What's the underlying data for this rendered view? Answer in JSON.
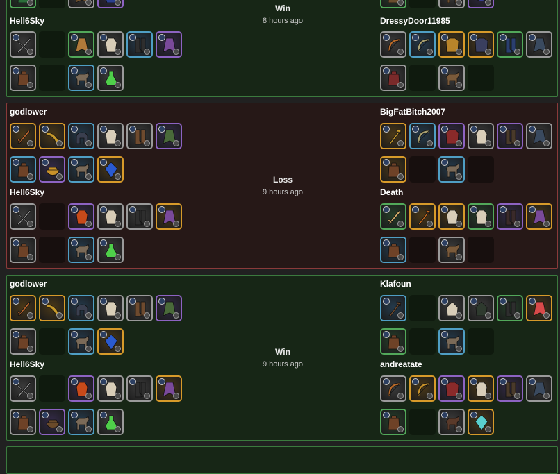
{
  "matches": [
    {
      "kind": "win",
      "result": "Win",
      "time": "8 hours ago",
      "left": [
        {
          "rows": [
            [
              {
                "q": "green",
                "c": "#2b6f3a",
                "icon": "bag-icon"
              },
              {
                "q": "empty"
              },
              {
                "q": "gray",
                "c": "#6b4e2e",
                "icon": "cape-icon"
              },
              {
                "q": "purple",
                "c": "#2a3f8f",
                "icon": "potion-icon"
              }
            ]
          ]
        },
        {
          "name": "Hell6Sky",
          "rows": [
            [
              {
                "q": "gray",
                "c": "#9a9a9a",
                "icon": "crossbow-icon"
              },
              {
                "q": "empty"
              },
              {
                "q": "green",
                "c": "#b07a3a",
                "icon": "cape-icon"
              },
              {
                "q": "gray",
                "c": "#d8cdb8",
                "icon": "robe-icon"
              },
              {
                "q": "blue",
                "c": "#2e2e2e",
                "icon": "boots-icon"
              },
              {
                "q": "purple",
                "c": "#7a4a9a",
                "icon": "cape-icon"
              }
            ],
            [
              {
                "q": "gray",
                "c": "#6e4227",
                "icon": "bag-icon"
              },
              {
                "q": "empty"
              },
              {
                "q": "blue",
                "c": "#7a6a58",
                "icon": "mount-icon"
              },
              {
                "q": "gray",
                "c": "#4fcf4a",
                "icon": "potion-icon"
              }
            ]
          ]
        }
      ],
      "right": [
        {
          "rows": [
            [
              {
                "q": "green",
                "c": "#6b4e2e",
                "icon": "bag-icon"
              },
              {
                "q": "empty"
              },
              {
                "q": "gray",
                "c": "#6b4e2e",
                "icon": "mount-icon"
              },
              {
                "q": "purple",
                "c": "#3a3f8f",
                "icon": "food-icon"
              }
            ]
          ]
        },
        {
          "name": "DressyDoor11985",
          "rows": [
            [
              {
                "q": "gray",
                "c": "#b86a2a",
                "icon": "bow-icon"
              },
              {
                "q": "blue",
                "c": "#a8a070",
                "icon": "bow-icon"
              },
              {
                "q": "gold",
                "c": "#b8842a",
                "icon": "jacket-icon"
              },
              {
                "q": "gold",
                "c": "#3a3f5f",
                "icon": "jacket-icon"
              },
              {
                "q": "green",
                "c": "#2a3f6f",
                "icon": "boots-icon"
              },
              {
                "q": "gray",
                "c": "#3a4a5f",
                "icon": "cape-icon"
              }
            ],
            [
              {
                "q": "gray",
                "c": "#7a2a2a",
                "icon": "bag-icon"
              },
              {
                "q": "empty"
              },
              {
                "q": "gray",
                "c": "#7a5a3a",
                "icon": "mount-icon"
              },
              {
                "q": "empty"
              }
            ]
          ]
        }
      ]
    },
    {
      "kind": "loss",
      "result": "Loss",
      "time": "9 hours ago",
      "left": [
        {
          "name": "godlower",
          "rows": [
            [
              {
                "q": "gold",
                "c": "#b8642a",
                "icon": "sword-icon"
              },
              {
                "q": "gold",
                "c": "#c89a2a",
                "icon": "horn-icon"
              },
              {
                "q": "blue",
                "c": "#3a3f4f",
                "icon": "helmet-icon"
              },
              {
                "q": "gray",
                "c": "#d8cdb8",
                "icon": "robe-icon"
              },
              {
                "q": "gray",
                "c": "#6e4a2e",
                "icon": "boots-icon"
              },
              {
                "q": "purple",
                "c": "#4a6a3a",
                "icon": "cape-icon"
              }
            ],
            [
              {
                "q": "blue",
                "c": "#6e4227",
                "icon": "bag-icon"
              },
              {
                "q": "purple",
                "c": "#c8922a",
                "icon": "food-icon"
              },
              {
                "q": "blue",
                "c": "#7a6a58",
                "icon": "mount-icon"
              },
              {
                "q": "gold",
                "c": "#2a5acf",
                "icon": "gem-icon"
              }
            ]
          ]
        },
        {
          "name": "Hell6Sky",
          "rows": [
            [
              {
                "q": "gray",
                "c": "#9a9a9a",
                "icon": "crossbow-icon"
              },
              {
                "q": "empty"
              },
              {
                "q": "purple",
                "c": "#c84a1a",
                "icon": "robe-icon"
              },
              {
                "q": "gray",
                "c": "#d8cdb8",
                "icon": "robe-icon"
              },
              {
                "q": "gray",
                "c": "#2e2e2e",
                "icon": "boots-icon"
              },
              {
                "q": "gold",
                "c": "#7a4a9a",
                "icon": "cape-icon"
              }
            ],
            [
              {
                "q": "gray",
                "c": "#6e4227",
                "icon": "bag-icon"
              },
              {
                "q": "empty"
              },
              {
                "q": "blue",
                "c": "#7a6a58",
                "icon": "mount-icon"
              },
              {
                "q": "gray",
                "c": "#4fcf4a",
                "icon": "potion-icon"
              }
            ]
          ]
        }
      ],
      "right": [
        {
          "name": "BigFatBitch2007",
          "rows": [
            [
              {
                "q": "gold",
                "c": "#c89a2a",
                "icon": "staff-icon"
              },
              {
                "q": "blue",
                "c": "#a8a070",
                "icon": "bow-icon"
              },
              {
                "q": "purple",
                "c": "#8a2a2a",
                "icon": "jacket-icon"
              },
              {
                "q": "gray",
                "c": "#d8cdb8",
                "icon": "robe-icon"
              },
              {
                "q": "purple",
                "c": "#4a3a2a",
                "icon": "boots-icon"
              },
              {
                "q": "gray",
                "c": "#3a4a5f",
                "icon": "cape-icon"
              }
            ],
            [
              {
                "q": "gold",
                "c": "#6e4227",
                "icon": "bag-icon"
              },
              {
                "q": "empty"
              },
              {
                "q": "blue",
                "c": "#7a6a58",
                "icon": "mount-icon"
              },
              {
                "q": "empty"
              }
            ]
          ]
        },
        {
          "name": "Death",
          "rows": [
            [
              {
                "q": "green",
                "c": "#d8b06a",
                "icon": "sword-icon"
              },
              {
                "q": "gold",
                "c": "#c86a1a",
                "icon": "staff-icon"
              },
              {
                "q": "gold",
                "c": "#d8cdb8",
                "icon": "robe-icon"
              },
              {
                "q": "green",
                "c": "#d8cdb8",
                "icon": "robe-icon"
              },
              {
                "q": "purple",
                "c": "#3a2a2a",
                "icon": "boots-icon"
              },
              {
                "q": "gold",
                "c": "#7a4a9a",
                "icon": "cape-icon"
              }
            ],
            [
              {
                "q": "blue",
                "c": "#6e4227",
                "icon": "bag-icon"
              },
              {
                "q": "empty"
              },
              {
                "q": "gray",
                "c": "#7a5a3a",
                "icon": "mount-icon"
              },
              {
                "q": "empty"
              }
            ]
          ]
        }
      ]
    },
    {
      "kind": "win",
      "result": "Win",
      "time": "9 hours ago",
      "left": [
        {
          "name": "godlower",
          "rows": [
            [
              {
                "q": "gold",
                "c": "#b8642a",
                "icon": "sword-icon"
              },
              {
                "q": "gold",
                "c": "#c89a2a",
                "icon": "horn-icon"
              },
              {
                "q": "blue",
                "c": "#3a3f4f",
                "icon": "helmet-icon"
              },
              {
                "q": "gray",
                "c": "#d8cdb8",
                "icon": "robe-icon"
              },
              {
                "q": "gray",
                "c": "#6e4a2e",
                "icon": "boots-icon"
              },
              {
                "q": "purple",
                "c": "#4a6a3a",
                "icon": "cape-icon"
              }
            ],
            [
              {
                "q": "gray",
                "c": "#6e4227",
                "icon": "bag-icon"
              },
              {
                "q": "empty"
              },
              {
                "q": "blue",
                "c": "#7a6a58",
                "icon": "mount-icon"
              },
              {
                "q": "gold",
                "c": "#2a5acf",
                "icon": "gem-icon"
              }
            ]
          ]
        },
        {
          "name": "Hell6Sky",
          "rows": [
            [
              {
                "q": "gray",
                "c": "#9a9a9a",
                "icon": "crossbow-icon"
              },
              {
                "q": "empty"
              },
              {
                "q": "purple",
                "c": "#c84a1a",
                "icon": "robe-icon"
              },
              {
                "q": "gray",
                "c": "#d8cdb8",
                "icon": "robe-icon"
              },
              {
                "q": "gray",
                "c": "#2e2e2e",
                "icon": "boots-icon"
              },
              {
                "q": "gold",
                "c": "#7a4a9a",
                "icon": "cape-icon"
              }
            ],
            [
              {
                "q": "gray",
                "c": "#6e4227",
                "icon": "bag-icon"
              },
              {
                "q": "purple",
                "c": "#6a4a2a",
                "icon": "food-icon"
              },
              {
                "q": "blue",
                "c": "#7a6a58",
                "icon": "mount-icon"
              },
              {
                "q": "gray",
                "c": "#4fcf4a",
                "icon": "potion-icon"
              }
            ]
          ]
        }
      ],
      "right": [
        {
          "name": "Klafoun",
          "rows": [
            [
              {
                "q": "blue",
                "c": "#6e4a2e",
                "icon": "staff-icon"
              },
              {
                "q": "empty"
              },
              {
                "q": "gray",
                "c": "#d8cdb8",
                "icon": "hood-icon"
              },
              {
                "q": "gray",
                "c": "#2e3a2e",
                "icon": "hood-icon"
              },
              {
                "q": "green",
                "c": "#2e2e2e",
                "icon": "boots-icon"
              },
              {
                "q": "gold",
                "c": "#d84a4a",
                "icon": "cape-icon"
              }
            ],
            [
              {
                "q": "green",
                "c": "#6e4227",
                "icon": "bag-icon"
              },
              {
                "q": "empty"
              },
              {
                "q": "blue",
                "c": "#7a6a58",
                "icon": "mount-icon"
              },
              {
                "q": "empty"
              }
            ]
          ]
        },
        {
          "name": "andreatate",
          "rows": [
            [
              {
                "q": "gray",
                "c": "#b86a2a",
                "icon": "bow-icon"
              },
              {
                "q": "gold",
                "c": "#c8922a",
                "icon": "bow-icon"
              },
              {
                "q": "purple",
                "c": "#8a2a2a",
                "icon": "jacket-icon"
              },
              {
                "q": "gold",
                "c": "#d8cdb8",
                "icon": "robe-icon"
              },
              {
                "q": "purple",
                "c": "#4a3a2a",
                "icon": "boots-icon"
              },
              {
                "q": "gray",
                "c": "#3a4a5f",
                "icon": "cape-icon"
              }
            ],
            [
              {
                "q": "green",
                "c": "#6e4227",
                "icon": "bag-icon"
              },
              {
                "q": "empty"
              },
              {
                "q": "gray",
                "c": "#5a3a2a",
                "icon": "mount-icon"
              },
              {
                "q": "gold",
                "c": "#5acfcf",
                "icon": "gem-icon"
              }
            ]
          ]
        }
      ]
    }
  ]
}
